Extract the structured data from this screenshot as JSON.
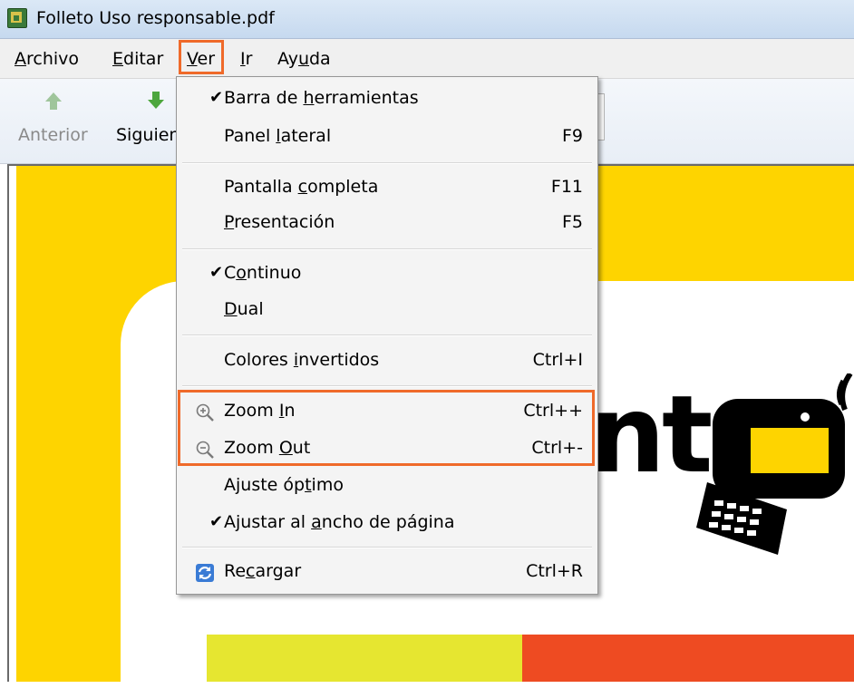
{
  "window": {
    "title": "Folleto Uso responsable.pdf",
    "icon": "pdf-app-icon"
  },
  "menubar": {
    "items": [
      {
        "pre": "",
        "accel": "A",
        "post": "rchivo"
      },
      {
        "pre": "",
        "accel": "E",
        "post": "ditar"
      },
      {
        "pre": "",
        "accel": "V",
        "post": "er"
      },
      {
        "pre": "",
        "accel": "I",
        "post": "r"
      },
      {
        "pre": "Ay",
        "accel": "u",
        "post": "da"
      }
    ]
  },
  "toolbar": {
    "prev_label": "Anterior",
    "next_label": "Siguiente",
    "prev_icon": "arrow-up-icon",
    "next_icon": "arrow-down-icon"
  },
  "view_menu": {
    "items": [
      {
        "pre": "Barra de ",
        "accel": "h",
        "post": "erramientas",
        "shortcut": "",
        "checked": true
      },
      {
        "pre": "Panel ",
        "accel": "l",
        "post": "ateral",
        "shortcut": "F9",
        "checked": false
      },
      {
        "pre": "Pantalla ",
        "accel": "c",
        "post": "ompleta",
        "shortcut": "F11",
        "checked": false
      },
      {
        "pre": "",
        "accel": "P",
        "post": "resentación",
        "shortcut": "F5",
        "checked": false
      },
      {
        "pre": "C",
        "accel": "o",
        "post": "ntinuo",
        "shortcut": "",
        "checked": true
      },
      {
        "pre": "",
        "accel": "D",
        "post": "ual",
        "shortcut": "",
        "checked": false
      },
      {
        "pre": "Colores ",
        "accel": "i",
        "post": "nvertidos",
        "shortcut": "Ctrl+I",
        "checked": false
      },
      {
        "pre": "Zoom ",
        "accel": "I",
        "post": "n",
        "shortcut": "Ctrl++",
        "checked": false,
        "icon": "zoom-in-icon"
      },
      {
        "pre": "Zoom ",
        "accel": "O",
        "post": "ut",
        "shortcut": "Ctrl+-",
        "checked": false,
        "icon": "zoom-out-icon"
      },
      {
        "pre": "Ajuste óp",
        "accel": "t",
        "post": "imo",
        "shortcut": "",
        "checked": false
      },
      {
        "pre": "Ajustar al ",
        "accel": "a",
        "post": "ncho de página",
        "shortcut": "",
        "checked": true
      },
      {
        "pre": "Re",
        "accel": "c",
        "post": "argar",
        "shortcut": "Ctrl+R",
        "checked": false,
        "icon": "reload-icon"
      }
    ],
    "check_glyph": "✔"
  },
  "document": {
    "logo_fragment": "nt"
  },
  "colors": {
    "highlight": "#ef6a2a",
    "page_yellow": "#fed400",
    "stripe_yellow": "#e6e630",
    "stripe_red": "#ee4b22"
  }
}
